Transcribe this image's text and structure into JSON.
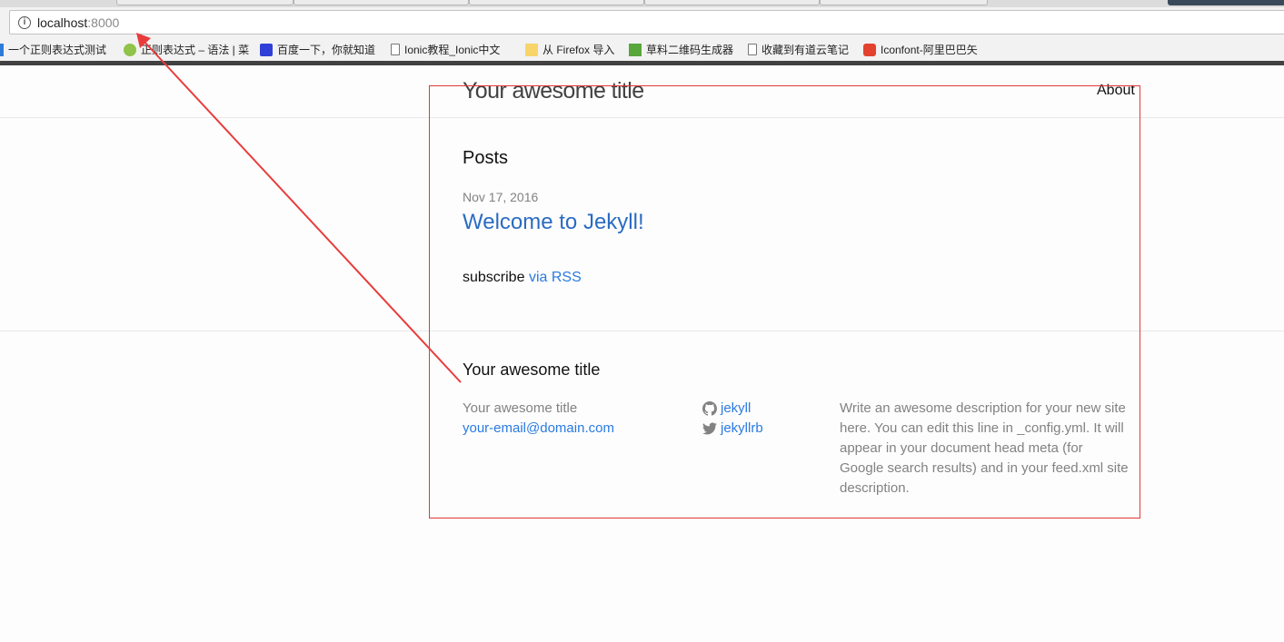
{
  "browser": {
    "url_host": "localhost",
    "url_port": ":8000",
    "bookmarks": [
      "一个正则表达式测试",
      "正则表达式 – 语法 | 菜",
      "百度一下，你就知道",
      "Ionic教程_Ionic中文",
      "从 Firefox 导入",
      "草料二维码生成器",
      "收藏到有道云笔记",
      "Iconfont-阿里巴巴矢"
    ]
  },
  "header": {
    "site_title": "Your awesome title",
    "nav_about": "About"
  },
  "main": {
    "posts_heading": "Posts",
    "post_date": "Nov 17, 2016",
    "post_title": "Welcome to Jekyll!",
    "subscribe_text": "subscribe",
    "rss_link": "via RSS"
  },
  "footer": {
    "heading": "Your awesome title",
    "name": "Your awesome title",
    "email": "your-email@domain.com",
    "github_user": "jekyll",
    "twitter_user": "jekyllrb",
    "description": "Write an awesome description for your new site here. You can edit this line in _config.yml. It will appear in your document head meta (for Google search results) and in your feed.xml site description."
  },
  "annotation_color": "#e03838",
  "link_color": "#2a7ae2"
}
